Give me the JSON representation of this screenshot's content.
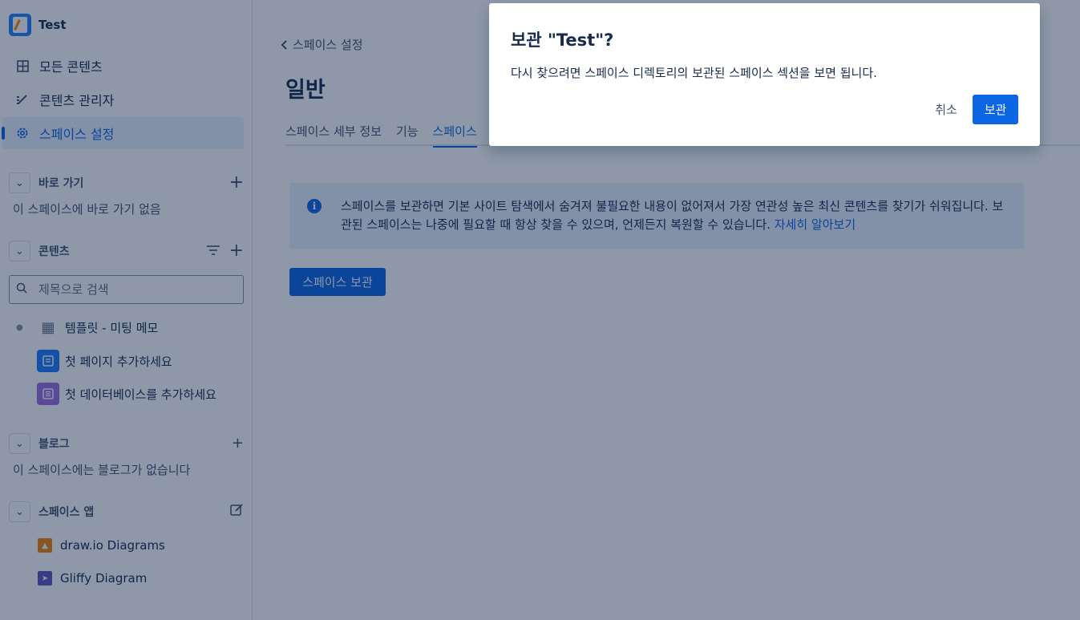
{
  "sidebar": {
    "space_name": "Test",
    "nav": [
      {
        "label": "모든 콘텐츠",
        "icon": "grid-icon"
      },
      {
        "label": "콘텐츠 관리자",
        "icon": "pen-icon"
      },
      {
        "label": "스페이스 설정",
        "icon": "gear-icon",
        "active": true
      }
    ],
    "shortcuts": {
      "title": "바로 가기",
      "empty": "이 스페이스에 바로 가기 없음"
    },
    "content": {
      "title": "콘텐츠",
      "search_placeholder": "제목으로 검색",
      "items": [
        {
          "label": "템플릿 - 미팅 메모",
          "icon": "template-icon"
        },
        {
          "label": "첫 페이지 추가하세요",
          "icon": "page-icon"
        },
        {
          "label": "첫 데이터베이스를 추가하세요",
          "icon": "database-icon"
        }
      ]
    },
    "blog": {
      "title": "블로그",
      "empty": "이 스페이스에는 블로그가 없습니다"
    },
    "apps": {
      "title": "스페이스 앱",
      "items": [
        {
          "label": "draw.io Diagrams",
          "icon": "drawio-icon"
        },
        {
          "label": "Gliffy Diagram",
          "icon": "gliffy-icon"
        }
      ]
    }
  },
  "main": {
    "back_label": "스페이스 설정",
    "heading": "일반",
    "tabs": [
      "스페이스 세부 정보",
      "기능",
      "스페이스"
    ],
    "active_tab_index": 2,
    "info": {
      "text": "스페이스를 보관하면 기본 사이트 탐색에서 숨겨져 불필요한 내용이 없어져서 가장 연관성 높은 최신 콘텐츠를 찾기가 쉬워집니다. 보관된 스페이스는 나중에 필요할 때 항상 찾을 수 있으며, 언제든지 복원할 수 있습니다.",
      "link": "자세히 알아보기"
    },
    "archive_button": "스페이스 보관"
  },
  "modal": {
    "title": "보관 \"Test\"?",
    "body": "다시 찾으려면 스페이스 디렉토리의 보관된 스페이스 섹션을 보면 됩니다.",
    "cancel": "취소",
    "confirm": "보관"
  },
  "colors": {
    "accent": "#0c66e4",
    "overlay": "rgba(9,30,66,0.46)"
  }
}
